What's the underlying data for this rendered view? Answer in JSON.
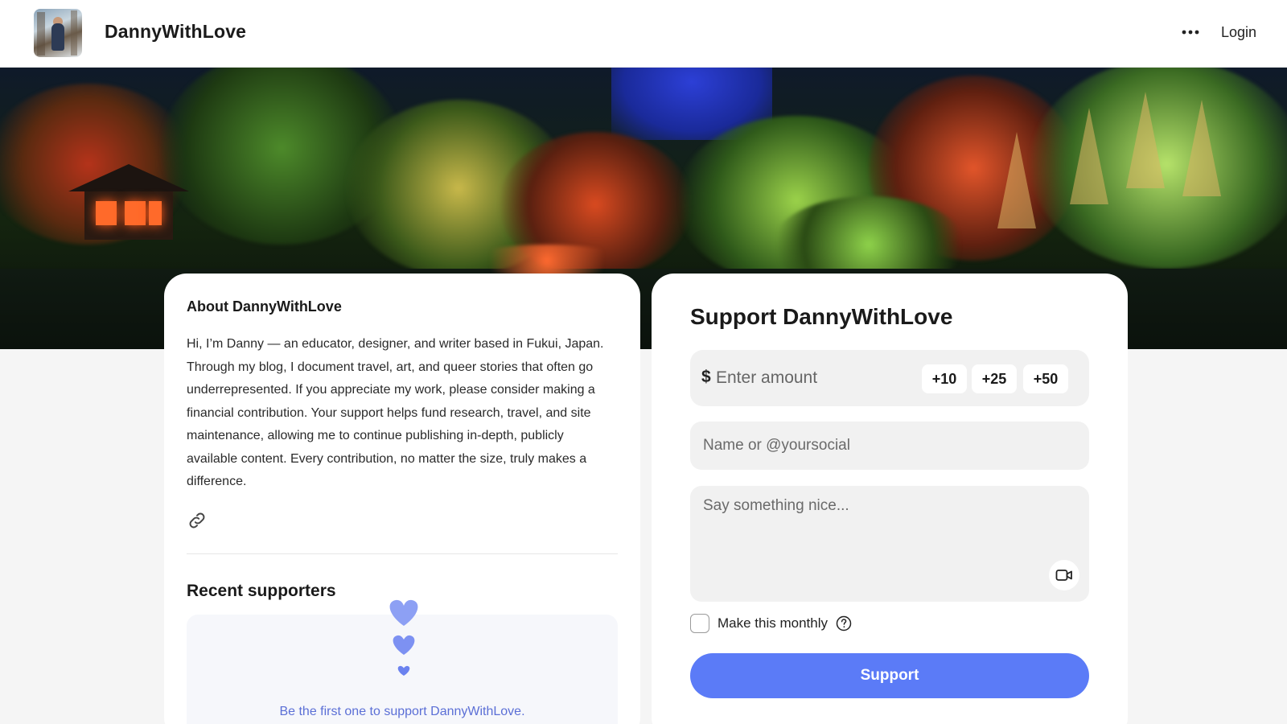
{
  "header": {
    "site_title": "DannyWithLove",
    "more_label": "•••",
    "login_label": "Login"
  },
  "about": {
    "title": "About DannyWithLove",
    "text": "Hi, I’m Danny — an educator, designer, and writer based in Fukui, Japan. Through my blog, I document travel, art, and queer stories that often go underrepresented. If you appreciate my work, please consider making a financial contribution. Your support helps fund research, travel, and site maintenance, allowing me to continue publishing in-depth, publicly available content. Every contribution, no matter the size, truly makes a difference."
  },
  "recent": {
    "title": "Recent supporters",
    "empty_text": "Be the first one to support DannyWithLove."
  },
  "support": {
    "title": "Support DannyWithLove",
    "currency_symbol": "$",
    "amount_placeholder": "Enter amount",
    "chips": [
      "+10",
      "+25",
      "+50"
    ],
    "name_placeholder": "Name or @yoursocial",
    "message_placeholder": "Say something nice...",
    "monthly_label": "Make this monthly",
    "monthly_checked": false,
    "button_label": "Support"
  },
  "colors": {
    "accent": "#5b7bf7",
    "empty_text": "#5b6fd6",
    "heart": "#7d91f2"
  },
  "icons": [
    "more-dots-icon",
    "link-icon",
    "heart-icon",
    "video-camera-icon",
    "help-circle-icon"
  ]
}
